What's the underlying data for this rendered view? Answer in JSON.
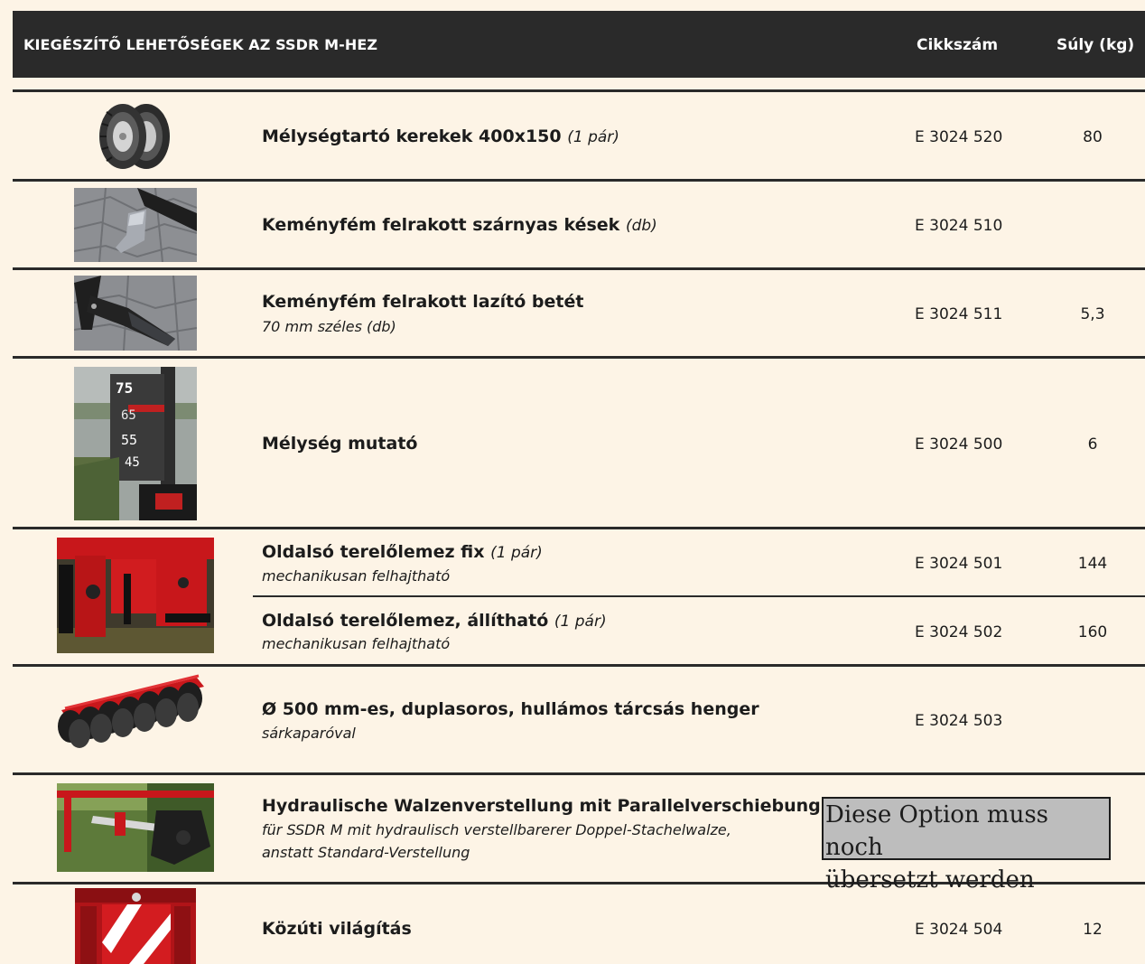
{
  "header": {
    "title": "KIEGÉSZÍTŐ LEHETŐSÉGEK AZ SSDR M-HEZ",
    "col_article": "Cikkszám",
    "col_weight": "Súly (kg)"
  },
  "rows": [
    {
      "title": "Mélységtartó kerekek 400x150",
      "note": "(1 pár)",
      "sub": "",
      "article": "E 3024 520",
      "weight": "80",
      "image": "tire-pair-icon"
    },
    {
      "title": "Keményfém felrakott szárnyas kések",
      "note": "(db)",
      "sub": "",
      "article": "E 3024 510",
      "weight": "",
      "image": "winged-blade-photo"
    },
    {
      "title": "Keményfém felrakott lazító betét",
      "note": "",
      "sub": "70 mm széles (db)",
      "article": "E 3024 511",
      "weight": "5,3",
      "image": "loosening-tine-photo"
    },
    {
      "title": "Mélység mutató",
      "note": "",
      "sub": "",
      "article": "E 3024 500",
      "weight": "6",
      "image": "depth-indicator-photo",
      "scale_labels": [
        "75",
        "65",
        "55",
        "45"
      ]
    },
    {
      "title": "Oldalsó terelőlemez fix",
      "note": "(1 pár)",
      "sub": "mechanikusan felhajtható",
      "article": "E 3024 501",
      "weight": "144",
      "image": "side-deflector-photo"
    },
    {
      "title": "Oldalsó terelőlemez, állítható",
      "note": "(1 pár)",
      "sub": "mechanikusan felhajtható",
      "article": "E 3024 502",
      "weight": "160",
      "image": ""
    },
    {
      "title": "Ø 500 mm-es, duplasoros, hullámos tárcsás henger",
      "note": "",
      "sub": "sárkaparóval",
      "article": "E 3024 503",
      "weight": "",
      "image": "disc-roller-photo"
    },
    {
      "title": "Hydraulische Walzenverstellung mit Parallelverschiebung",
      "note": "",
      "sub": "für SSDR M mit hydraulisch verstellbarerer Doppel-Stachelwalze,",
      "sub2": "anstatt Standard-Verstellung",
      "article": "",
      "weight": "",
      "image": "hydraulic-roller-photo"
    },
    {
      "title": "Közúti világítás",
      "note": "",
      "sub": "",
      "article": "E 3024 504",
      "weight": "12",
      "image": "road-lighting-photo"
    }
  ],
  "overlay": {
    "line1": "Diese Option muss noch",
    "line2": "übersetzt werden"
  },
  "colors": {
    "background": "#fdf4e6",
    "header": "#2a2a2a",
    "overlay_fill": "#bdbdbd",
    "accent_red": "#c8171b"
  }
}
